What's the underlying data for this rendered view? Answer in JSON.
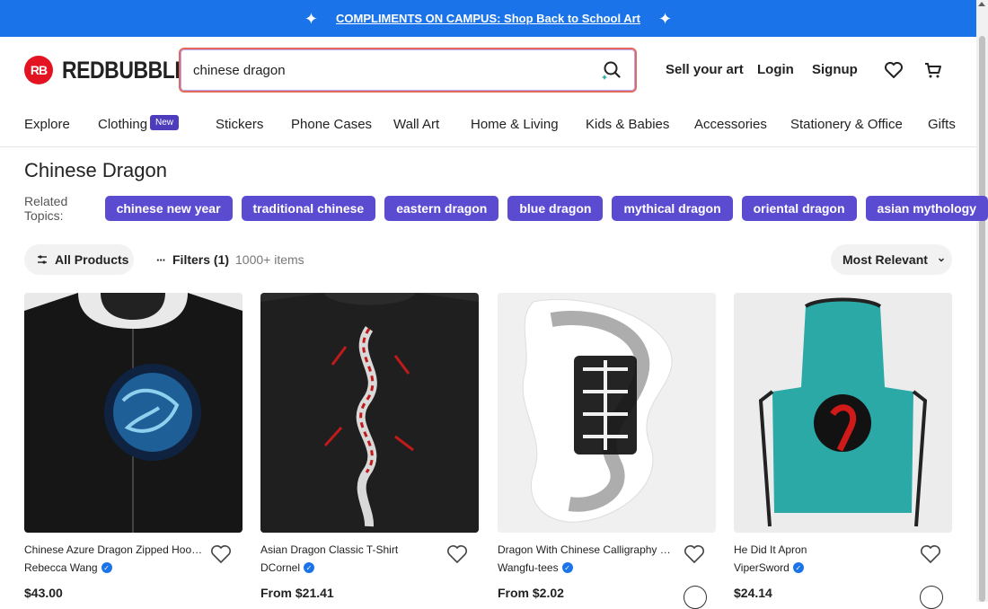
{
  "banner": {
    "text": "COMPLIMENTS ON CAMPUS: Shop Back to School Art",
    "sparkle_icon": "sparkle-icon"
  },
  "header": {
    "logo_text": "REDBUBBLE",
    "logo_mark": "RB",
    "search_value": "chinese dragon",
    "sell_label": "Sell your art",
    "login_label": "Login",
    "signup_label": "Signup",
    "wishlist_icon": "heart-icon",
    "cart_icon": "cart-icon"
  },
  "nav": {
    "items": [
      "Explore",
      "Clothing",
      "Stickers",
      "Phone Cases",
      "Wall Art",
      "Home & Living",
      "Kids & Babies",
      "Accessories",
      "Stationery & Office",
      "Gifts"
    ],
    "badge": "New"
  },
  "page_title": "Chinese Dragon",
  "related": {
    "label": "Related Topics:",
    "topics": [
      "chinese new year",
      "traditional chinese",
      "eastern dragon",
      "blue dragon",
      "mythical dragon",
      "oriental dragon",
      "asian mythology"
    ]
  },
  "toolbar": {
    "all_products": "All Products",
    "filters": "Filters (1)",
    "count": "1000+ items",
    "sort": "Most Relevant"
  },
  "products": [
    {
      "title": "Chinese Azure Dragon Zipped Hoodie",
      "artist": "Rebecca Wang",
      "price": "$43.00"
    },
    {
      "title": "Asian Dragon Classic T-Shirt",
      "artist": "DCornel",
      "price": "From $21.41"
    },
    {
      "title": "Dragon With Chinese Calligraphy Sticker",
      "artist": "Wangfu-tees",
      "price": "From $2.02"
    },
    {
      "title": "He Did It Apron",
      "artist": "ViperSword",
      "price": "$24.14"
    }
  ],
  "colors": {
    "banner": "#1a73e8",
    "brand_red": "#e41321",
    "chip": "#5b4bd1",
    "badge": "#4d3dbd",
    "verified": "#1a73e8"
  }
}
